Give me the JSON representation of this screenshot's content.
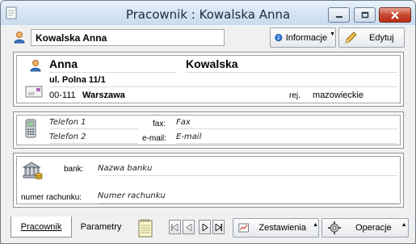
{
  "window": {
    "title": "Pracownik : Kowalska Anna"
  },
  "toolbar": {
    "name_value": "Kowalska Anna",
    "info_label": "Informacje",
    "edit_label": "Edytuj"
  },
  "person": {
    "first_name": "Anna",
    "last_name": "Kowalska",
    "street": "ul. Polna 11/1",
    "postal_code": "00-111",
    "city": "Warszawa",
    "region_label": "rej.",
    "region": "mazowieckie"
  },
  "contact": {
    "phone1": "Telefon 1",
    "phone2": "Telefon 2",
    "fax_label": "fax:",
    "fax": "Fax",
    "email_label": "e-mail:",
    "email": "E-mail"
  },
  "bank": {
    "bank_label": "bank:",
    "bank_name": "Nazwa banku",
    "account_label": "numer rachunku:",
    "account_number": "Numer rachunku"
  },
  "bottom": {
    "tabs": [
      {
        "label": "Pracownik"
      },
      {
        "label": "Parametry"
      }
    ],
    "reports_label": "Zestawienia",
    "operations_label": "Operacje"
  },
  "colors": {
    "title_bg": "#d6e4f3",
    "close_red": "#c8482f",
    "panel_border": "#8e8f8f"
  }
}
